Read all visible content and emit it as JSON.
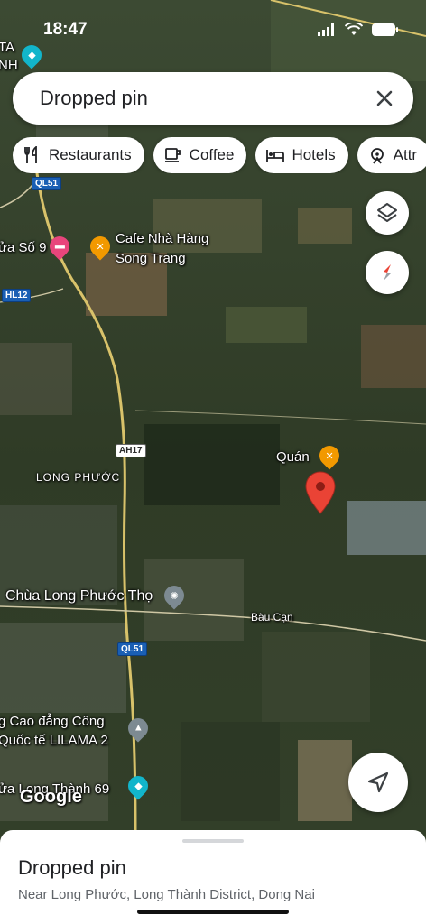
{
  "status_bar": {
    "time": "18:47"
  },
  "search": {
    "title": "Dropped pin"
  },
  "chips": [
    {
      "label": "Restaurants",
      "icon": "restaurant-icon"
    },
    {
      "label": "Coffee",
      "icon": "coffee-icon"
    },
    {
      "label": "Hotels",
      "icon": "hotel-icon"
    },
    {
      "label": "Attr",
      "icon": "attractions-icon"
    }
  ],
  "map": {
    "labels": {
      "cafe_line1": "Cafe Nhà Hàng",
      "cafe_line2": "Song Trang",
      "hotel_partial": "ửa Số 9",
      "long_phuoc": "LONG PHƯỚC",
      "chua": "Chùa Long Phước Thọ",
      "bau_can": "Bàu Cạn",
      "quan": "Quán",
      "college_line1": "g Cao đẳng Công",
      "college_line2": "Quốc tế LILAMA 2",
      "school_partial": "ửa Long Thành 69",
      "top_left_1": "TA",
      "top_left_2": "NH"
    },
    "shields": {
      "ql51_top": "QL51",
      "hl12": "HL12",
      "ah17": "AH17",
      "ql51_bottom": "QL51"
    },
    "attribution": "Google"
  },
  "sheet": {
    "title": "Dropped pin",
    "subtitle": "Near Long Phước, Long Thành District, Dong Nai"
  },
  "colors": {
    "pin": "#ea4335",
    "poi_food": "#f29900",
    "poi_hotel": "#e8457c",
    "poi_school": "#12b5cb"
  }
}
